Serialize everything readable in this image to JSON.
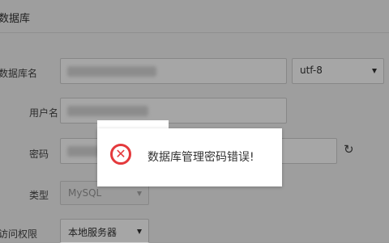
{
  "header": {
    "title": "数据库"
  },
  "form": {
    "db_name": {
      "label": "数据库名",
      "charset": "utf-8"
    },
    "username": {
      "label": "用户名"
    },
    "password": {
      "label": "密码"
    },
    "type": {
      "label": "类型",
      "value": "MySQL"
    },
    "access": {
      "label": "访问权限",
      "value": "本地服务器"
    }
  },
  "dialog": {
    "message": "数据库管理密码错误!",
    "icon": "error-circle-icon"
  },
  "colors": {
    "error": "#e4393c",
    "background": "#f3f3f3"
  }
}
